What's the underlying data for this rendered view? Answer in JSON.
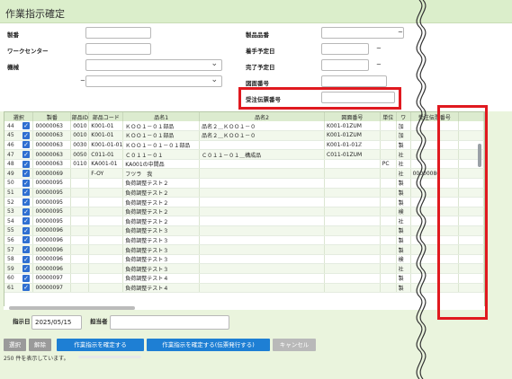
{
  "page": {
    "title": "作業指示確定"
  },
  "form": {
    "labels": {
      "seiban": "製番",
      "work_center": "ワークセンター",
      "machine": "機械",
      "product_code": "製品品番",
      "start_date": "着手予定日",
      "end_date": "完了予定日",
      "drawing_no": "図面番号",
      "order_slip_no": "受注伝票番号"
    },
    "tilde": "~"
  },
  "grid": {
    "headers": [
      "選択",
      "製番",
      "部品ID",
      "部品コード",
      "品名1",
      "品名2",
      "図面番号",
      "単位",
      "ワ",
      "受注伝票番号"
    ],
    "rows": [
      {
        "n": "44",
        "seiban": "00000063",
        "pid": "0010",
        "code": "K001-01",
        "name1": "ＫＯＯ１－０１部品",
        "name2": "品名２＿ＫＯＯ１－０",
        "draw": "K001-01ZUM",
        "unit": "",
        "w": "加",
        "order": ""
      },
      {
        "n": "45",
        "seiban": "00000063",
        "pid": "0010",
        "code": "K001-01",
        "name1": "ＫＯＯ１－０１部品",
        "name2": "品名２＿ＫＯＯ１－０",
        "draw": "K001-01ZUM",
        "unit": "",
        "w": "加",
        "order": ""
      },
      {
        "n": "46",
        "seiban": "00000063",
        "pid": "0030",
        "code": "K001-01-01",
        "name1": "ＫＯＯ１－０１－０１部品",
        "name2": "",
        "draw": "K001-01-01ℤ",
        "unit": "",
        "w": "製",
        "order": ""
      },
      {
        "n": "47",
        "seiban": "00000063",
        "pid": "0050",
        "code": "C011-01",
        "name1": "Ｃ０１１－０１",
        "name2": "Ｃ０１１－０１＿構成品",
        "draw": "C011-01ZUM",
        "unit": "",
        "w": "社",
        "order": ""
      },
      {
        "n": "48",
        "seiban": "00000063",
        "pid": "0110",
        "code": "KA001-01",
        "name1": "KA001の中間品",
        "name2": "",
        "draw": "",
        "unit": "PC",
        "w": "社",
        "order": ""
      },
      {
        "n": "49",
        "seiban": "00000069",
        "pid": "",
        "code": "F-OY",
        "name1": "フツラ　我",
        "name2": "",
        "draw": "",
        "unit": "",
        "w": "社",
        "order": "00000086"
      },
      {
        "n": "50",
        "seiban": "00000095",
        "pid": "",
        "code": "",
        "name1": "負荷調整テスト２",
        "name2": "",
        "draw": "",
        "unit": "",
        "w": "製",
        "order": ""
      },
      {
        "n": "51",
        "seiban": "00000095",
        "pid": "",
        "code": "",
        "name1": "負荷調整テスト２",
        "name2": "",
        "draw": "",
        "unit": "",
        "w": "製",
        "order": ""
      },
      {
        "n": "52",
        "seiban": "00000095",
        "pid": "",
        "code": "",
        "name1": "負荷調整テスト２",
        "name2": "",
        "draw": "",
        "unit": "",
        "w": "製",
        "order": ""
      },
      {
        "n": "53",
        "seiban": "00000095",
        "pid": "",
        "code": "",
        "name1": "負荷調整テスト２",
        "name2": "",
        "draw": "",
        "unit": "",
        "w": "検",
        "order": ""
      },
      {
        "n": "54",
        "seiban": "00000095",
        "pid": "",
        "code": "",
        "name1": "負荷調整テスト２",
        "name2": "",
        "draw": "",
        "unit": "",
        "w": "社",
        "order": ""
      },
      {
        "n": "55",
        "seiban": "00000096",
        "pid": "",
        "code": "",
        "name1": "負荷調整テスト３",
        "name2": "",
        "draw": "",
        "unit": "",
        "w": "製",
        "order": ""
      },
      {
        "n": "56",
        "seiban": "00000096",
        "pid": "",
        "code": "",
        "name1": "負荷調整テスト３",
        "name2": "",
        "draw": "",
        "unit": "",
        "w": "製",
        "order": ""
      },
      {
        "n": "57",
        "seiban": "00000096",
        "pid": "",
        "code": "",
        "name1": "負荷調整テスト３",
        "name2": "",
        "draw": "",
        "unit": "",
        "w": "製",
        "order": ""
      },
      {
        "n": "58",
        "seiban": "00000096",
        "pid": "",
        "code": "",
        "name1": "負荷調整テスト３",
        "name2": "",
        "draw": "",
        "unit": "",
        "w": "検",
        "order": ""
      },
      {
        "n": "59",
        "seiban": "00000096",
        "pid": "",
        "code": "",
        "name1": "負荷調整テスト３",
        "name2": "",
        "draw": "",
        "unit": "",
        "w": "社",
        "order": ""
      },
      {
        "n": "60",
        "seiban": "00000097",
        "pid": "",
        "code": "",
        "name1": "負荷調整テスト４",
        "name2": "",
        "draw": "",
        "unit": "",
        "w": "製",
        "order": ""
      },
      {
        "n": "61",
        "seiban": "00000097",
        "pid": "",
        "code": "",
        "name1": "負荷調整テスト４",
        "name2": "",
        "draw": "",
        "unit": "",
        "w": "製",
        "order": ""
      }
    ]
  },
  "footer": {
    "instruction_date_label": "指示日",
    "instruction_date_value": "2025/05/15",
    "person_label": "担当者",
    "buttons": {
      "select": "選択",
      "cancel_select": "解除",
      "confirm": "作業指示を確定する",
      "confirm_issue": "作業指示を確定する(伝票発行する)",
      "cancel": "キャンセル"
    },
    "status": "250 件を表示しています。"
  },
  "colors": {
    "highlight": "#e0191f",
    "primary_button": "#1e7fd4",
    "header_green": "#dbeecb"
  }
}
